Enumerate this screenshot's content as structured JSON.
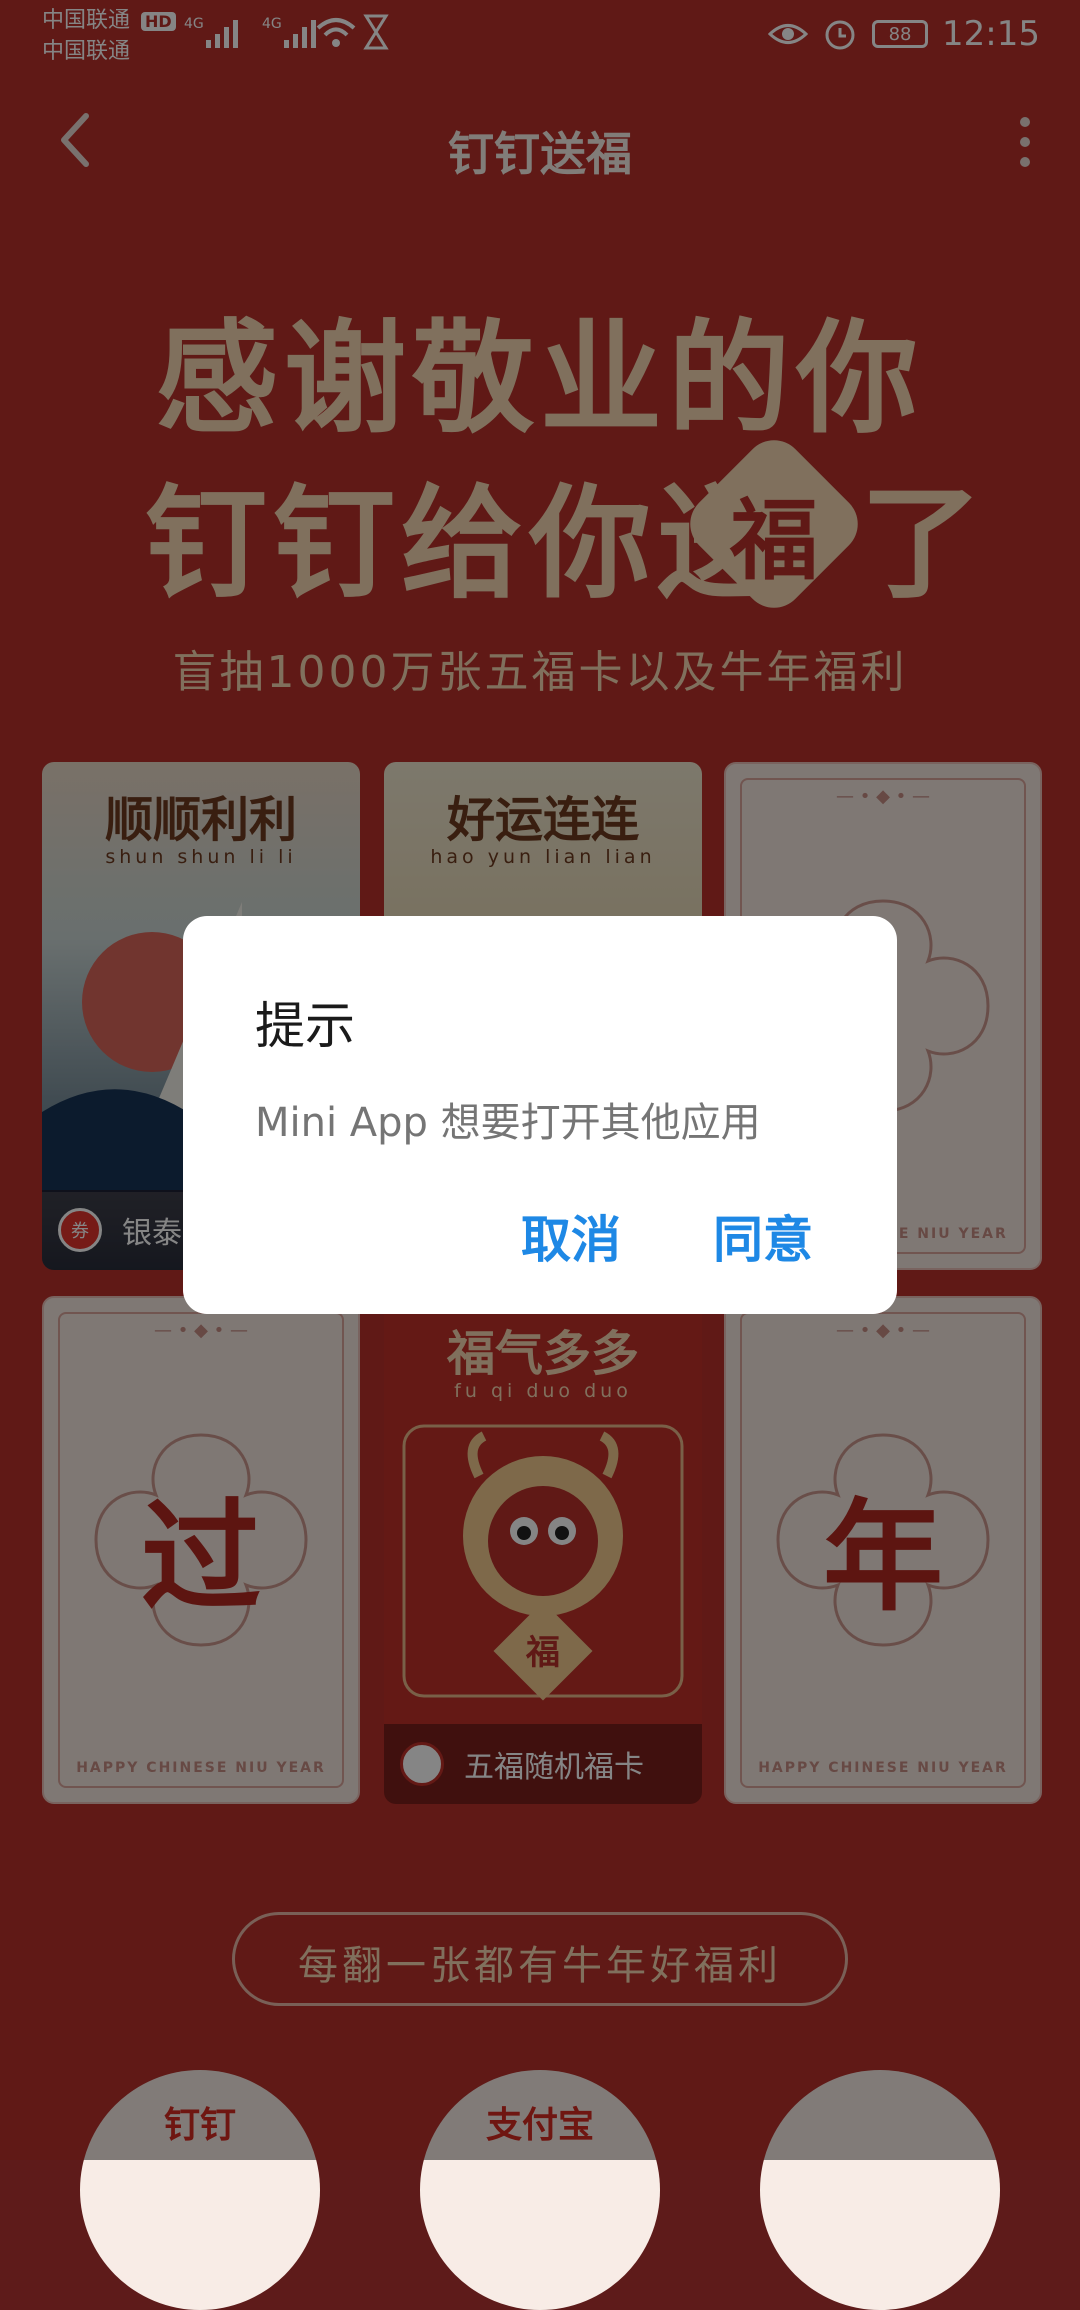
{
  "status_bar": {
    "carrier_1": "中国联通",
    "carrier_1_badge": "HD",
    "carrier_2": "中国联通",
    "net_1": "4G",
    "net_2": "4G",
    "battery": "88",
    "time": "12:15"
  },
  "header": {
    "title": "钉钉送福"
  },
  "hero": {
    "line_1": "感谢敬业的你",
    "line_2": "钉钉给你送",
    "fu_char": "福",
    "line_2_end": "了",
    "subtitle": "盲抽1000万张五福卡以及牛年福利"
  },
  "cards": [
    {
      "title": "顺顺利利",
      "pinyin": "shun shun li li",
      "label": "银泰",
      "coupon": "券"
    },
    {
      "title": "好运连连",
      "pinyin": "hao yun lian lian"
    },
    {
      "char": "",
      "footer": "HAPPY CHINESE NIU YEAR"
    },
    {
      "char": "过",
      "footer": "HAPPY CHINESE NIU YEAR"
    },
    {
      "title": "福气多多",
      "pinyin": "fu qi duo duo",
      "label": "五福随机福卡",
      "badge_char": "福"
    },
    {
      "char": "年",
      "footer": "HAPPY CHINESE NIU YEAR"
    }
  ],
  "banner": {
    "text": "每翻一张都有牛年好福利"
  },
  "partners": [
    "钉钉",
    "支付宝",
    ""
  ],
  "dialog": {
    "title": "提示",
    "message": "Mini App 想要打开其他应用",
    "cancel": "取消",
    "agree": "同意"
  },
  "colors": {
    "background": "#b8302b",
    "dialog_button": "#1e88e5",
    "hero_text": "#f6d7b3"
  }
}
